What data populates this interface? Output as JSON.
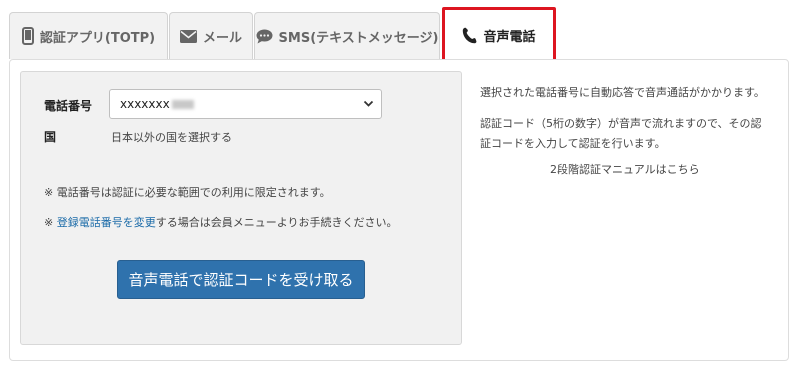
{
  "tabs": [
    {
      "label": "認証アプリ(TOTP)",
      "icon": "mobile-icon",
      "active": false
    },
    {
      "label": "メール",
      "icon": "envelope-icon",
      "active": false
    },
    {
      "label": "SMS(テキストメッセージ)",
      "icon": "chat-bubble-icon",
      "active": false
    },
    {
      "label": "音声電話",
      "icon": "phone-icon",
      "active": true
    }
  ],
  "form": {
    "phone_label": "電話番号",
    "phone_value": "xxxxxxx",
    "country_label": "国",
    "country_link": "日本以外の国を選択する",
    "note1": "※ 電話番号は認証に必要な範囲での利用に限定されます。",
    "note2_prefix": "※ ",
    "note2_link": "登録電話番号を変更",
    "note2_suffix": "する場合は会員メニューよりお手続きください。",
    "submit_label": "音声電話で認証コードを受け取る"
  },
  "description": {
    "line1": "選択された電話番号に自動応答で音声通話がかかります。",
    "line2": "認証コード（5桁の数字）が音声で流れますので、その認",
    "line3": "証コードを入力して認証を行います。",
    "manual_link": "2段階認証マニュアルはこちら"
  },
  "colors": {
    "accent_blue": "#2f72ad",
    "link_blue": "#1a6aa8",
    "highlight_red": "#dd1520"
  }
}
